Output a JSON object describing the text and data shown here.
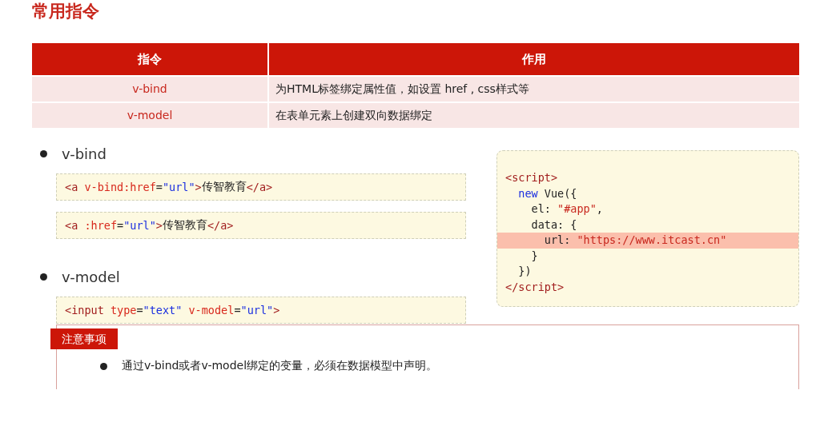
{
  "title": "常用指令",
  "table": {
    "columns": [
      "指令",
      "作用"
    ],
    "rows": [
      [
        "v-bind",
        "为HTML标签绑定属性值，如设置 href , css样式等"
      ],
      [
        "v-model",
        "在表单元素上创建双向数据绑定"
      ]
    ]
  },
  "sections": [
    {
      "heading": "v-bind",
      "snippets": [
        [
          {
            "kind": "tag",
            "text": "<a "
          },
          {
            "kind": "attr",
            "text": "v-bind:href"
          },
          {
            "kind": "plain",
            "text": "="
          },
          {
            "kind": "str",
            "text": "\"url\""
          },
          {
            "kind": "tag",
            "text": ">"
          },
          {
            "kind": "plain",
            "text": "传智教育"
          },
          {
            "kind": "tag",
            "text": "</a>"
          }
        ],
        [
          {
            "kind": "tag",
            "text": "<a "
          },
          {
            "kind": "attr",
            "text": ":href"
          },
          {
            "kind": "plain",
            "text": "="
          },
          {
            "kind": "str",
            "text": "\"url\""
          },
          {
            "kind": "tag",
            "text": ">"
          },
          {
            "kind": "plain",
            "text": "传智教育"
          },
          {
            "kind": "tag",
            "text": "</a>"
          }
        ]
      ]
    },
    {
      "heading": "v-model",
      "snippets": [
        [
          {
            "kind": "tag",
            "text": "<input "
          },
          {
            "kind": "attr",
            "text": "type"
          },
          {
            "kind": "plain",
            "text": "="
          },
          {
            "kind": "str",
            "text": "\"text\""
          },
          {
            "kind": "attr",
            "text": " v-model"
          },
          {
            "kind": "plain",
            "text": "="
          },
          {
            "kind": "str",
            "text": "\"url\""
          },
          {
            "kind": "tag",
            "text": ">"
          }
        ]
      ]
    }
  ],
  "script_code": [
    {
      "highlighted": false,
      "tokens": [
        {
          "kind": "tag",
          "text": "<script>"
        }
      ]
    },
    {
      "highlighted": false,
      "tokens": [
        {
          "kind": "kw",
          "text": "  new"
        },
        {
          "kind": "plain",
          "text": " Vue({"
        }
      ]
    },
    {
      "highlighted": false,
      "tokens": [
        {
          "kind": "plain",
          "text": "    el: "
        },
        {
          "kind": "strred",
          "text": "\"#app\""
        },
        {
          "kind": "plain",
          "text": ","
        }
      ]
    },
    {
      "highlighted": false,
      "tokens": [
        {
          "kind": "plain",
          "text": "    data: {"
        }
      ]
    },
    {
      "highlighted": true,
      "tokens": [
        {
          "kind": "plain",
          "text": "      url: "
        },
        {
          "kind": "strred",
          "text": "\"https://www.itcast.cn\""
        }
      ]
    },
    {
      "highlighted": false,
      "tokens": [
        {
          "kind": "plain",
          "text": "    }"
        }
      ]
    },
    {
      "highlighted": false,
      "tokens": [
        {
          "kind": "plain",
          "text": "  })"
        }
      ]
    },
    {
      "highlighted": false,
      "tokens": [
        {
          "kind": "tag",
          "text": "</script>"
        }
      ]
    }
  ],
  "note": {
    "label": "注意事项",
    "items": [
      "通过v-bind或者v-model绑定的变量，必须在数据模型中声明。"
    ]
  }
}
